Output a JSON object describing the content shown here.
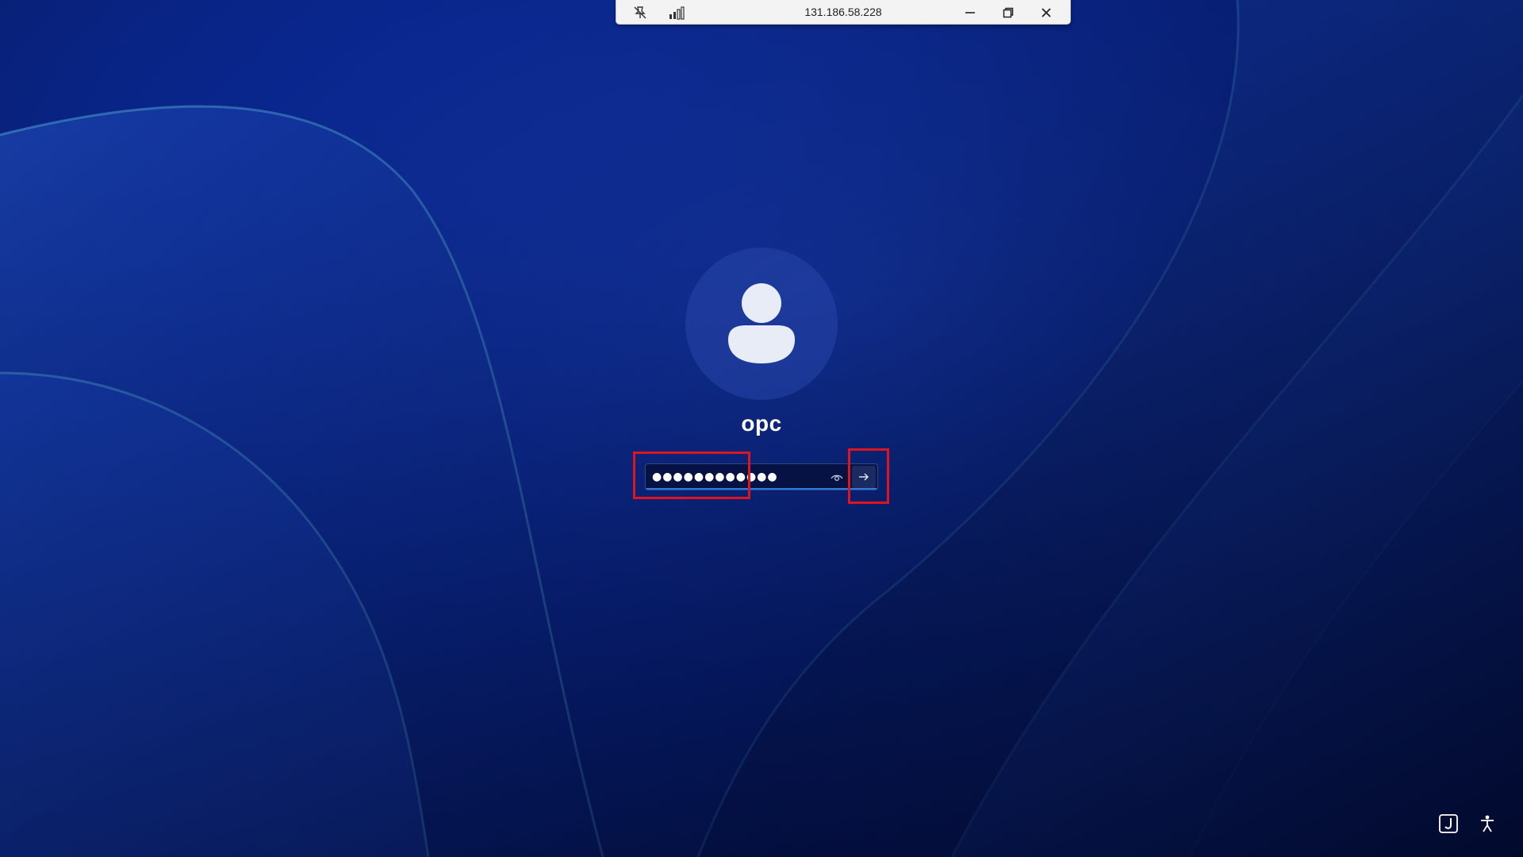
{
  "rdp_bar": {
    "host": "131.186.58.228",
    "icons": {
      "pin": "unpin-icon",
      "signal": "connection-signal-icon",
      "minimize": "minimize-icon",
      "restore": "restore-icon",
      "close": "close-icon"
    }
  },
  "login": {
    "username": "opc",
    "password_value": "●●●●●●●●●●●●",
    "icons": {
      "avatar": "user-avatar-icon",
      "reveal": "reveal-password-icon",
      "submit": "arrow-right-icon"
    }
  },
  "corner": {
    "icons": {
      "language": "input-indicator-icon",
      "accessibility": "accessibility-icon"
    }
  },
  "colors": {
    "background": "#0a2fa6",
    "highlight": "#e0141e",
    "input_underline": "#2a7be0",
    "text": "#ffffff"
  }
}
